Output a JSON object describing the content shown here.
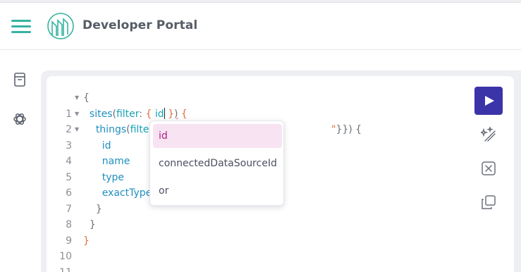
{
  "header": {
    "brand": "Developer Portal",
    "menu_icon": "hamburger-menu-icon",
    "logo_icon": "developer-portal-logo"
  },
  "sidebar": {
    "items": [
      {
        "icon": "docs-book-icon"
      },
      {
        "icon": "openai-assistant-icon"
      }
    ]
  },
  "editor": {
    "line_numbers": [
      "1",
      "2",
      "3",
      "4",
      "5",
      "6",
      "7",
      "8",
      "9",
      "10",
      "11"
    ],
    "code": {
      "l1_brace": "{",
      "l2_field": "sites",
      "l2_paren": "(",
      "l2_arg": "filter",
      "l2_colon": ": ",
      "l2_obrace": "{",
      "l2_key": " id",
      "l2_cbrace": "}",
      "l2_cparen": ")",
      "l2_open": " {",
      "l3_field": "things",
      "l3_paren": "(",
      "l3_arg": "filter",
      "l3_tail_quote": "\"",
      "l3_tail": "}}) {",
      "l4": "id",
      "l5": "name",
      "l6": "type",
      "l7": "exactType",
      "l8": "}",
      "l9": "}",
      "l10": "}"
    }
  },
  "autocomplete": {
    "items": [
      "id",
      "connectedDataSourceId",
      "or"
    ],
    "selected": "id"
  },
  "toolbar": {
    "run_icon": "play-icon",
    "prettify_icon": "magic-wand-icon",
    "merge_icon": "merge-fragments-icon",
    "copy_icon": "copy-icon"
  },
  "colors": {
    "accent": "#36b3a0",
    "run": "#3b34a8",
    "selected_bg": "#f7e3f2",
    "selected_text": "#b0208a",
    "field": "#1f8fbf",
    "brace": "#e0703c"
  }
}
